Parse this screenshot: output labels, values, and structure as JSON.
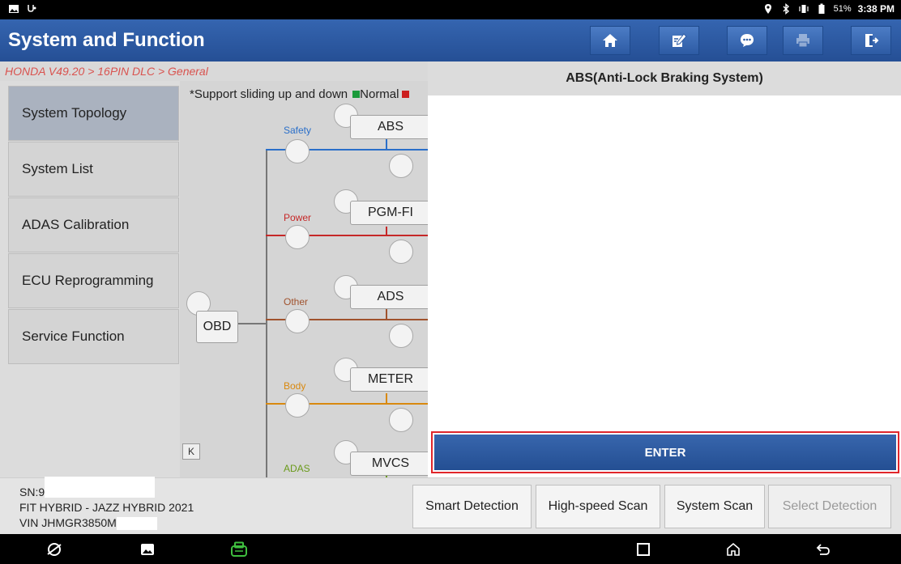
{
  "status_bar": {
    "battery_percent": "51%",
    "time": "3:38 PM"
  },
  "title_bar": {
    "title": "System and Function",
    "buttons": [
      {
        "icon": "home-icon"
      },
      {
        "icon": "edit-report-icon"
      },
      {
        "icon": "chat-icon"
      },
      {
        "icon": "print-icon",
        "disabled": true
      },
      {
        "icon": "exit-icon"
      }
    ]
  },
  "breadcrumb": "HONDA V49.20 > 16PIN DLC > General",
  "left_nav": {
    "items": [
      {
        "label": "System Topology",
        "active": true
      },
      {
        "label": "System List"
      },
      {
        "label": "ADAS Calibration"
      },
      {
        "label": "ECU Reprogramming"
      },
      {
        "label": "Service Function"
      }
    ],
    "collapse_glyph": "K"
  },
  "topology": {
    "legend_text": "*Support sliding up and down",
    "legend_normal": "Normal",
    "root_node": "OBD",
    "categories": [
      {
        "label": "Safety",
        "color": "#2a6fc9",
        "node": "ABS"
      },
      {
        "label": "Power",
        "color": "#c62828",
        "node": "PGM-FI"
      },
      {
        "label": "Other",
        "color": "#a0522d",
        "node": "ADS"
      },
      {
        "label": "Body",
        "color": "#d9890f",
        "node": "METER"
      },
      {
        "label": "ADAS",
        "color": "#6a9a1a",
        "node": "MVCS"
      }
    ]
  },
  "right_panel": {
    "header": "ABS(Anti-Lock Braking System)",
    "enter_label": "ENTER"
  },
  "vehicle": {
    "sn_label": "SN:9",
    "model": "FIT HYBRID - JAZZ HYBRID 2021",
    "vin_label": "VIN JHMGR3850M"
  },
  "bottom_buttons": [
    {
      "label": "Smart Detection"
    },
    {
      "label": "High-speed Scan"
    },
    {
      "label": "System Scan"
    },
    {
      "label": "Select Detection",
      "disabled": true
    }
  ],
  "colors": {
    "title_bar": "#2b5da8",
    "breadcrumb_text": "#d9534f",
    "enter_border": "#e0262b"
  }
}
